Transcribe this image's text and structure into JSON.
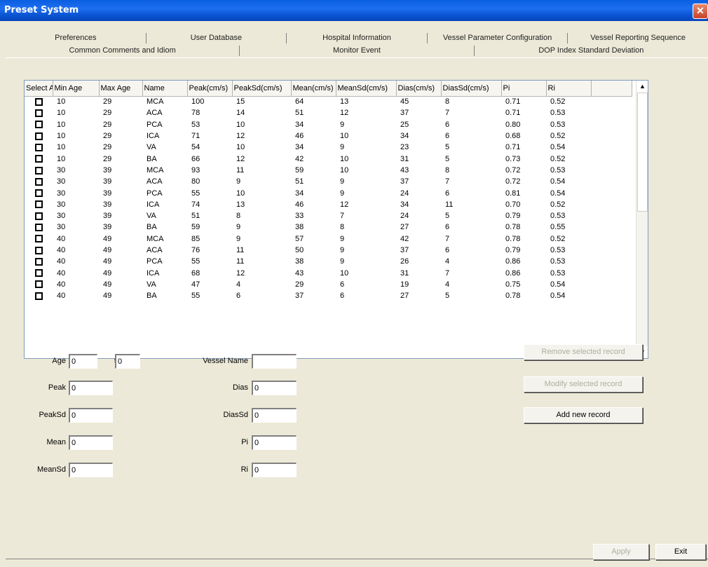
{
  "window": {
    "title": "Preset System"
  },
  "tabs_row1": [
    "Preferences",
    "User Database",
    "Hospital Information",
    "Vessel Parameter Configuration",
    "Vessel Reporting Sequence"
  ],
  "tabs_row2": [
    "Common Comments and Idiom",
    "Monitor Event",
    "DOP Index Standard Deviation"
  ],
  "active_tab": "DOP Index Standard Deviation",
  "grid": {
    "columns": [
      "Select A",
      "Min Age",
      "Max Age",
      "Name",
      "Peak(cm/s)",
      "PeakSd(cm/s)",
      "Mean(cm/s)",
      "MeanSd(cm/s)",
      "Dias(cm/s)",
      "DiasSd(cm/s)",
      "Pi",
      "Ri",
      ""
    ],
    "rows": [
      [
        "10",
        "29",
        "MCA",
        "100",
        "15",
        "64",
        "13",
        "45",
        "8",
        "0.71",
        "0.52"
      ],
      [
        "10",
        "29",
        "ACA",
        "78",
        "14",
        "51",
        "12",
        "37",
        "7",
        "0.71",
        "0.53"
      ],
      [
        "10",
        "29",
        "PCA",
        "53",
        "10",
        "34",
        "9",
        "25",
        "6",
        "0.80",
        "0.53"
      ],
      [
        "10",
        "29",
        "ICA",
        "71",
        "12",
        "46",
        "10",
        "34",
        "6",
        "0.68",
        "0.52"
      ],
      [
        "10",
        "29",
        "VA",
        "54",
        "10",
        "34",
        "9",
        "23",
        "5",
        "0.71",
        "0.54"
      ],
      [
        "10",
        "29",
        "BA",
        "66",
        "12",
        "42",
        "10",
        "31",
        "5",
        "0.73",
        "0.52"
      ],
      [
        "30",
        "39",
        "MCA",
        "93",
        "11",
        "59",
        "10",
        "43",
        "8",
        "0.72",
        "0.53"
      ],
      [
        "30",
        "39",
        "ACA",
        "80",
        "9",
        "51",
        "9",
        "37",
        "7",
        "0.72",
        "0.54"
      ],
      [
        "30",
        "39",
        "PCA",
        "55",
        "10",
        "34",
        "9",
        "24",
        "6",
        "0.81",
        "0.54"
      ],
      [
        "30",
        "39",
        "ICA",
        "74",
        "13",
        "46",
        "12",
        "34",
        "11",
        "0.70",
        "0.52"
      ],
      [
        "30",
        "39",
        "VA",
        "51",
        "8",
        "33",
        "7",
        "24",
        "5",
        "0.79",
        "0.53"
      ],
      [
        "30",
        "39",
        "BA",
        "59",
        "9",
        "38",
        "8",
        "27",
        "6",
        "0.78",
        "0.55"
      ],
      [
        "40",
        "49",
        "MCA",
        "85",
        "9",
        "57",
        "9",
        "42",
        "7",
        "0.78",
        "0.52"
      ],
      [
        "40",
        "49",
        "ACA",
        "76",
        "11",
        "50",
        "9",
        "37",
        "6",
        "0.79",
        "0.53"
      ],
      [
        "40",
        "49",
        "PCA",
        "55",
        "11",
        "38",
        "9",
        "26",
        "4",
        "0.86",
        "0.53"
      ],
      [
        "40",
        "49",
        "ICA",
        "68",
        "12",
        "43",
        "10",
        "31",
        "7",
        "0.86",
        "0.53"
      ],
      [
        "40",
        "49",
        "VA",
        "47",
        "4",
        "29",
        "6",
        "19",
        "4",
        "0.75",
        "0.54"
      ],
      [
        "40",
        "49",
        "BA",
        "55",
        "6",
        "37",
        "6",
        "27",
        "5",
        "0.78",
        "0.54"
      ]
    ]
  },
  "form": {
    "age_label": "Age",
    "age_value": "0",
    "to_label": "to",
    "to_value": "0",
    "vessel_name_label": "Vessel Name",
    "vessel_name_value": "",
    "peak_label": "Peak",
    "peak_value": "0",
    "dias_label": "Dias",
    "dias_value": "0",
    "peaksd_label": "PeakSd",
    "peaksd_value": "0",
    "diassd_label": "DiasSd",
    "diassd_value": "0",
    "mean_label": "Mean",
    "mean_value": "0",
    "pi_label": "Pi",
    "pi_value": "0",
    "meansd_label": "MeanSd",
    "meansd_value": "0",
    "ri_label": "Ri",
    "ri_value": "0"
  },
  "buttons": {
    "remove": "Remove selected record",
    "modify": "Modify selected record",
    "add": "Add new record",
    "apply": "Apply",
    "exit": "Exit"
  },
  "icons": {
    "close": "close-icon",
    "scroll_up": "scroll-up-icon",
    "scroll_down": "scroll-down-icon",
    "checkbox": "checkbox-icon"
  }
}
